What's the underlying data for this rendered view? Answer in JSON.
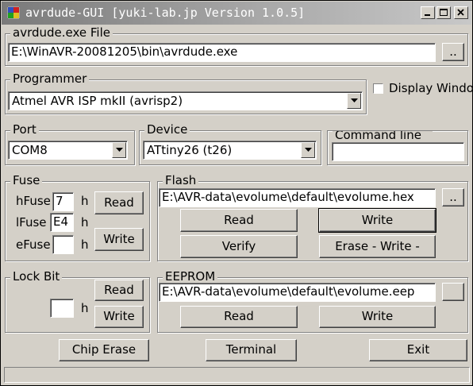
{
  "window": {
    "title": "avrdude-GUI [yuki-lab.jp Version 1.0.5]",
    "icons": [
      "app-icon",
      "minimize-icon",
      "maximize-icon",
      "close-icon"
    ]
  },
  "avrdude_file": {
    "legend": "avrdude.exe File",
    "path": "E:\\WinAVR-20081205\\bin\\avrdude.exe",
    "browse_label": ".."
  },
  "programmer": {
    "legend": "Programmer",
    "selected": "Atmel AVR ISP mkII (avrisp2)"
  },
  "display_window": {
    "label": "Display Window",
    "checked": false
  },
  "port": {
    "legend": "Port",
    "selected": "COM8"
  },
  "device": {
    "legend": "Device",
    "selected": "ATtiny26 (t26)"
  },
  "command_line": {
    "legend": "Command line Option",
    "value": ""
  },
  "fuse": {
    "legend": "Fuse",
    "hfuse_label": "hFuse",
    "hfuse_value": "7",
    "lfuse_label": "lFuse",
    "lfuse_value": "E4",
    "efuse_label": "eFuse",
    "efuse_value": "",
    "unit": "h",
    "read_label": "Read",
    "write_label": "Write"
  },
  "flash": {
    "legend": "Flash",
    "path": "E:\\AVR-data\\evolume\\default\\evolume.hex",
    "browse_label": "..",
    "read_label": "Read",
    "write_label": "Write",
    "verify_label": "Verify",
    "erase_write_label": "Erase - Write -"
  },
  "lock_bit": {
    "legend": "Lock Bit",
    "value": "",
    "unit": "h",
    "read_label": "Read",
    "write_label": "Write"
  },
  "eeprom": {
    "legend": "EEPROM",
    "path": "E:\\AVR-data\\evolume\\default\\evolume.eep",
    "browse_label": "",
    "read_label": "Read",
    "write_label": "Write"
  },
  "bottom": {
    "chip_erase_label": "Chip Erase",
    "terminal_label": "Terminal",
    "exit_label": "Exit"
  },
  "status_bar": {
    "text": ""
  }
}
